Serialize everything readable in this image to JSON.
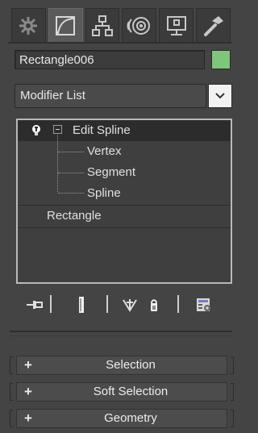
{
  "tabs": [
    {
      "icon": "create-icon",
      "active": false
    },
    {
      "icon": "modify-icon",
      "active": true
    },
    {
      "icon": "hierarchy-icon",
      "active": false
    },
    {
      "icon": "motion-icon",
      "active": false
    },
    {
      "icon": "display-icon",
      "active": false
    },
    {
      "icon": "utilities-icon",
      "active": false
    }
  ],
  "object": {
    "name": "Rectangle006",
    "color": "#7ec77a"
  },
  "modifier_list": {
    "label": "Modifier List"
  },
  "stack": {
    "items": [
      {
        "label": "Edit Spline",
        "selected": true
      },
      {
        "label": "Vertex"
      },
      {
        "label": "Segment"
      },
      {
        "label": "Spline"
      },
      {
        "label": "Rectangle"
      }
    ]
  },
  "toolbar": {
    "icons": [
      "pin-stack-icon",
      "show-end-result-icon",
      "make-unique-icon",
      "remove-modifier-icon",
      "configure-modifier-sets-icon"
    ]
  },
  "rollouts": [
    {
      "label": "Selection",
      "symbol": "+"
    },
    {
      "label": "Soft Selection",
      "symbol": "+"
    },
    {
      "label": "Geometry",
      "symbol": "+"
    }
  ]
}
